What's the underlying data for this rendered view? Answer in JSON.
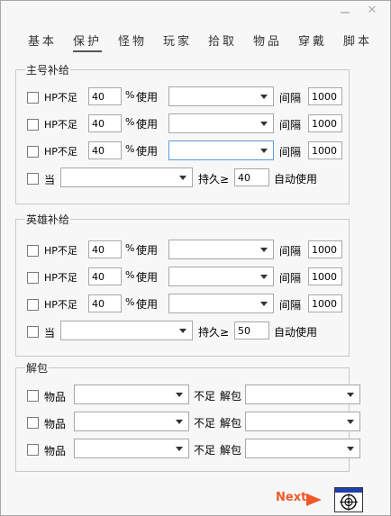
{
  "window": {
    "minimize_icon": "minimize-icon",
    "close_glyph": "✕"
  },
  "tabs": [
    "基本",
    "保护",
    "怪物",
    "玩家",
    "拾取",
    "物品",
    "穿戴",
    "脚本"
  ],
  "main_supply": {
    "legend": "主号补给",
    "rows": [
      {
        "label": "HP不足",
        "value": "40",
        "pct": "%",
        "use": "使用",
        "interval_label": "间隔",
        "interval": "1000"
      },
      {
        "label": "HP不足",
        "value": "40",
        "pct": "%",
        "use": "使用",
        "interval_label": "间隔",
        "interval": "1000"
      },
      {
        "label": "HP不足",
        "value": "40",
        "pct": "%",
        "use": "使用",
        "interval_label": "间隔",
        "interval": "1000"
      }
    ],
    "durability": {
      "label": "当",
      "dur_label": "持久≥",
      "value": "40",
      "auto_label": "自动使用"
    }
  },
  "hero_supply": {
    "legend": "英雄补给",
    "rows": [
      {
        "label": "HP不足",
        "value": "40",
        "pct": "%",
        "use": "使用",
        "interval_label": "间隔",
        "interval": "1000"
      },
      {
        "label": "HP不足",
        "value": "40",
        "pct": "%",
        "use": "使用",
        "interval_label": "间隔",
        "interval": "1000"
      },
      {
        "label": "HP不足",
        "value": "40",
        "pct": "%",
        "use": "使用",
        "interval_label": "间隔",
        "interval": "1000"
      }
    ],
    "durability": {
      "label": "当",
      "dur_label": "持久≥",
      "value": "50",
      "auto_label": "自动使用"
    }
  },
  "unpack": {
    "legend": "解包",
    "rows": [
      {
        "label": "物品",
        "insufficient": "不足",
        "unpack_label": "解包"
      },
      {
        "label": "物品",
        "insufficient": "不足",
        "unpack_label": "解包"
      },
      {
        "label": "物品",
        "insufficient": "不足",
        "unpack_label": "解包"
      }
    ]
  },
  "footer": {
    "next_label": "Next",
    "accent": "#f0592a",
    "logo_icon": "target-logo-icon"
  }
}
